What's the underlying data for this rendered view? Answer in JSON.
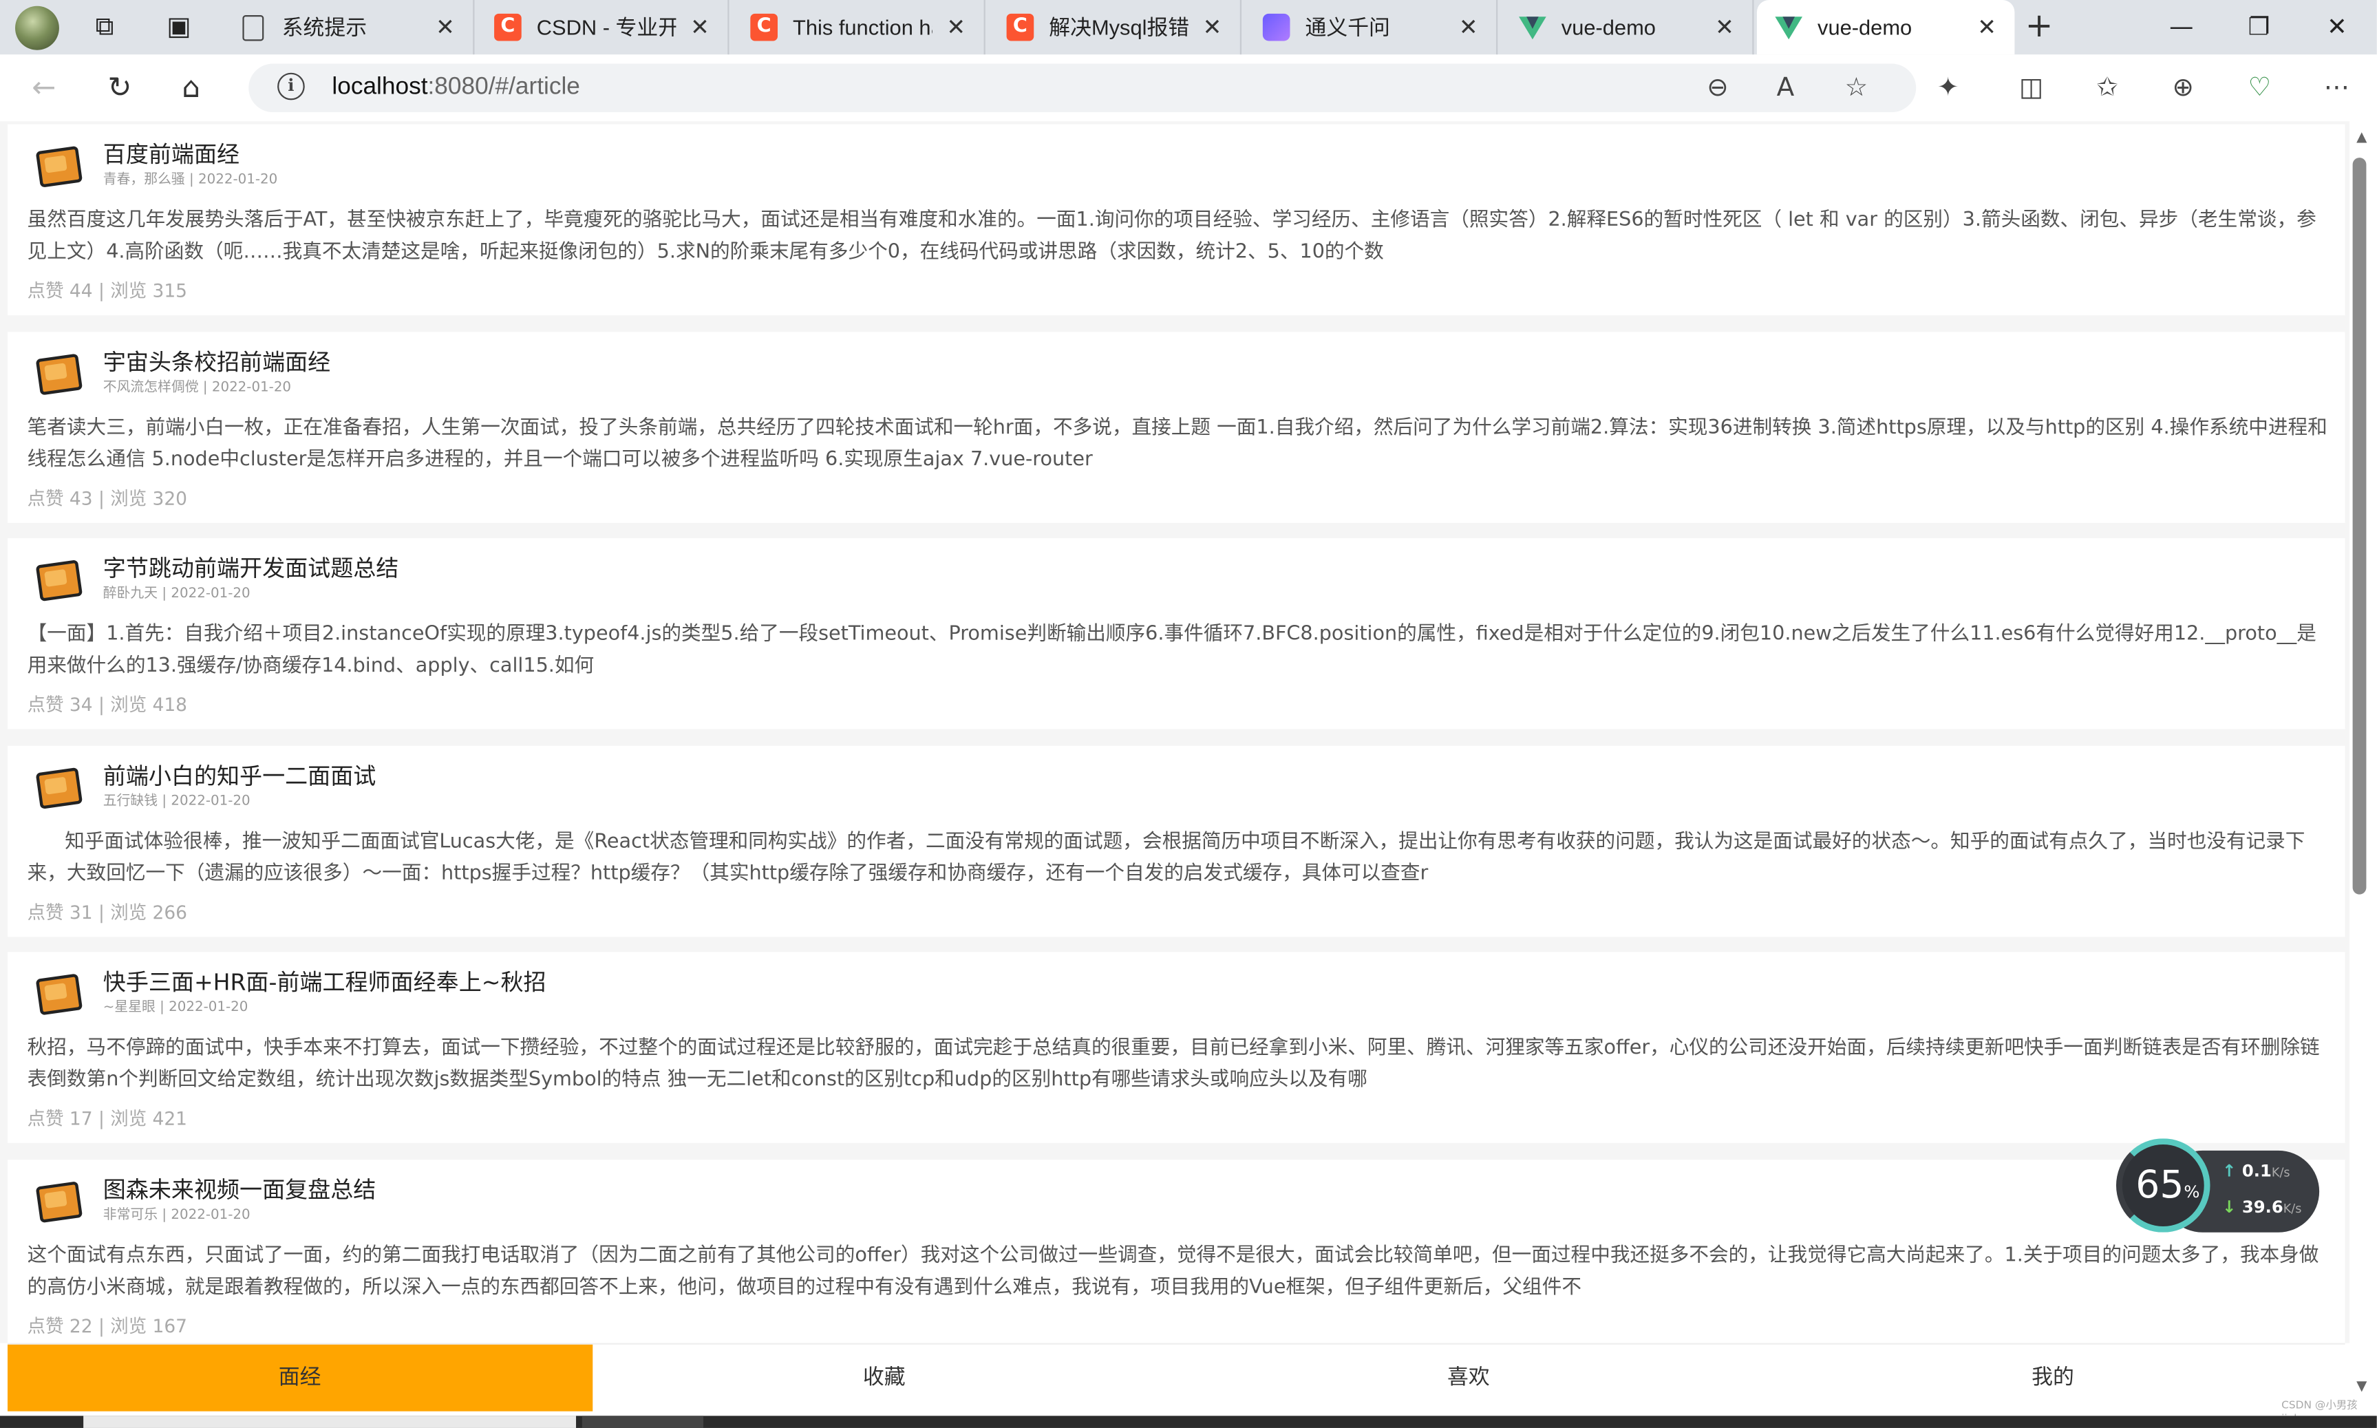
{
  "browser": {
    "tabs": [
      {
        "title": "系统提示",
        "icon": "document-icon"
      },
      {
        "title": "CSDN - 专业开发者社区",
        "icon": "csdn-icon"
      },
      {
        "title": "This function has none",
        "icon": "csdn-icon"
      },
      {
        "title": "解决Mysql报错",
        "icon": "csdn-icon"
      },
      {
        "title": "通义千问",
        "icon": "tongyi-icon"
      },
      {
        "title": "vue-demo",
        "icon": "vue-icon"
      },
      {
        "title": "vue-demo",
        "icon": "vue-icon"
      }
    ],
    "url_host": "localhost",
    "url_path": ":8080/#/article"
  },
  "articles": [
    {
      "title": "百度前端面经",
      "meta": "青春，那么骚 | 2022-01-20",
      "desc": "虽然百度这几年发展势头落后于AT，甚至快被京东赶上了，毕竟瘦死的骆驼比马大，面试还是相当有难度和水准的。一面1.询问你的项目经验、学习经历、主修语言（照实答）2.解释ES6的暂时性死区（ let 和 var 的区别）3.箭头函数、闭包、异步（老生常谈，参见上文）4.高阶函数（呃……我真不太清楚这是啥，听起来挺像闭包的）5.求N的阶乘末尾有多少个0，在线码代码或讲思路（求因数，统计2、5、10的个数",
      "stats": "点赞 44 | 浏览 315"
    },
    {
      "title": "宇宙头条校招前端面经",
      "meta": "不风流怎样倜傥 | 2022-01-20",
      "desc": "笔者读大三，前端小白一枚，正在准备春招，人生第一次面试，投了头条前端，总共经历了四轮技术面试和一轮hr面，不多说，直接上题 一面1.自我介绍，然后问了为什么学习前端2.算法：实现36进制转换 3.简述https原理，以及与http的区别 4.操作系统中进程和线程怎么通信 5.node中cluster是怎样开启多进程的，并且一个端口可以被多个进程监听吗 6.实现原生ajax 7.vue-router",
      "stats": "点赞 43 | 浏览 320"
    },
    {
      "title": "字节跳动前端开发面试题总结",
      "meta": "醉卧九天 | 2022-01-20",
      "desc": "【一面】1.首先：自我介绍＋项目2.instanceOf实现的原理3.typeof4.js的类型5.给了一段setTimeout、Promise判断输出顺序6.事件循环7.BFC8.position的属性，fixed是相对于什么定位的9.闭包10.new之后发生了什么11.es6有什么觉得好用12.__proto__是用来做什么的13.强缓存/协商缓存14.bind、apply、call15.如何",
      "stats": "点赞 34 | 浏览 418"
    },
    {
      "title": "前端小白的知乎一二面面试",
      "meta": "五行缺钱 | 2022-01-20",
      "desc": "      知乎面试体验很棒，推一波知乎二面面试官Lucas大佬，是《React状态管理和同构实战》的作者，二面没有常规的面试题，会根据简历中项目不断深入，提出让你有思考有收获的问题，我认为这是面试最好的状态～。知乎的面试有点久了，当时也没有记录下来，大致回忆一下（遗漏的应该很多）～一面：https握手过程？http缓存？（其实http缓存除了强缓存和协商缓存，还有一个自发的启发式缓存，具体可以查查r",
      "stats": "点赞 31 | 浏览 266"
    },
    {
      "title": "快手三面+HR面-前端工程师面经奉上~秋招",
      "meta": "~星星眼 | 2022-01-20",
      "desc": "秋招，马不停蹄的面试中，快手本来不打算去，面试一下攒经验，不过整个的面试过程还是比较舒服的，面试完趁于总结真的很重要，目前已经拿到小米、阿里、腾讯、河狸家等五家offer，心仪的公司还没开始面，后续持续更新吧快手一面判断链表是否有环删除链表倒数第n个判断回文给定数组，统计出现次数js数据类型Symbol的特点 独一无二let和const的区别tcp和udp的区别http有哪些请求头或响应头以及有哪",
      "stats": "点赞 17 | 浏览 421"
    },
    {
      "title": "图森未来视频一面复盘总结",
      "meta": "非常可乐 | 2022-01-20",
      "desc": "这个面试有点东西，只面试了一面，约的第二面我打电话取消了（因为二面之前有了其他公司的offer）我对这个公司做过一些调查，觉得不是很大，面试会比较简单吧，但一面过程中我还挺多不会的，让我觉得它高大尚起来了。1.关于项目的问题太多了，我本身做的高仿小米商城，就是跟着教程做的，所以深入一点的东西都回答不上来，他问，做项目的过程中有没有遇到什么难点，我说有，项目我用的Vue框架，但子组件更新后，父组件不",
      "stats": "点赞 22 | 浏览 167"
    }
  ],
  "bottom_nav": [
    "面经",
    "收藏",
    "喜欢",
    "我的"
  ],
  "net_widget": {
    "percent": "65",
    "percent_unit": "%",
    "up": "0.1",
    "down": "39.6",
    "unit": "K/s"
  },
  "watermark": "CSDN @小男孩jiale",
  "colors": {
    "accent": "#ffa500",
    "csdn": "#fc5531",
    "vue": "#41b883"
  }
}
